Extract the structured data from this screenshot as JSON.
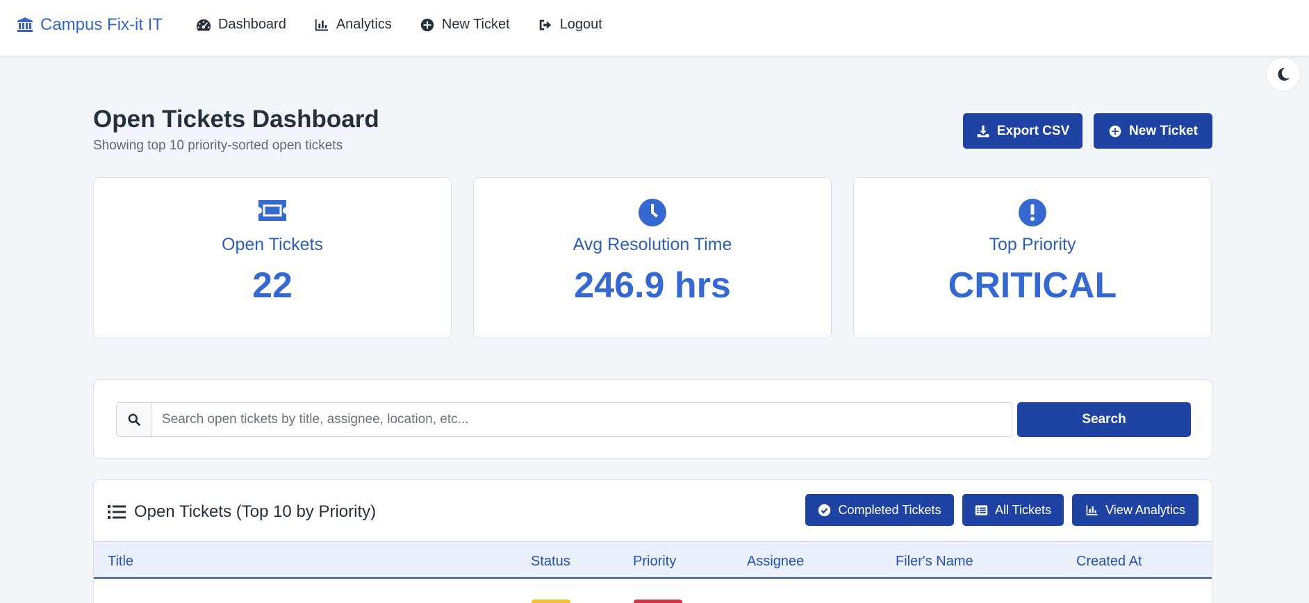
{
  "navbar": {
    "brand": "Campus Fix-it IT",
    "links": [
      {
        "label": "Dashboard",
        "icon": "tachometer-icon"
      },
      {
        "label": "Analytics",
        "icon": "bar-chart-icon"
      },
      {
        "label": "New Ticket",
        "icon": "plus-circle-icon"
      },
      {
        "label": "Logout",
        "icon": "sign-out-icon"
      }
    ]
  },
  "header": {
    "title": "Open Tickets Dashboard",
    "subtitle": "Showing top 10 priority-sorted open tickets",
    "export_label": "Export CSV",
    "new_ticket_label": "New Ticket"
  },
  "stats": [
    {
      "label": "Open Tickets",
      "value": "22",
      "icon": "ticket-icon"
    },
    {
      "label": "Avg Resolution Time",
      "value": "246.9 hrs",
      "icon": "clock-icon"
    },
    {
      "label": "Top Priority",
      "value": "CRITICAL",
      "icon": "exclamation-circle-icon"
    }
  ],
  "search": {
    "placeholder": "Search open tickets by title, assignee, location, etc...",
    "value": "",
    "button_label": "Search"
  },
  "table": {
    "title": "Open Tickets (Top 10 by Priority)",
    "buttons": {
      "completed": "Completed Tickets",
      "all": "All Tickets",
      "analytics": "View Analytics"
    },
    "columns": [
      "Title",
      "Status",
      "Priority",
      "Assignee",
      "Filer's Name",
      "Created At"
    ]
  },
  "colors": {
    "primary": "#1f43a3",
    "accent": "#3569cf",
    "background": "#f2f5fa",
    "status_badge": "#f2c12e",
    "priority_badge": "#d4314a"
  }
}
